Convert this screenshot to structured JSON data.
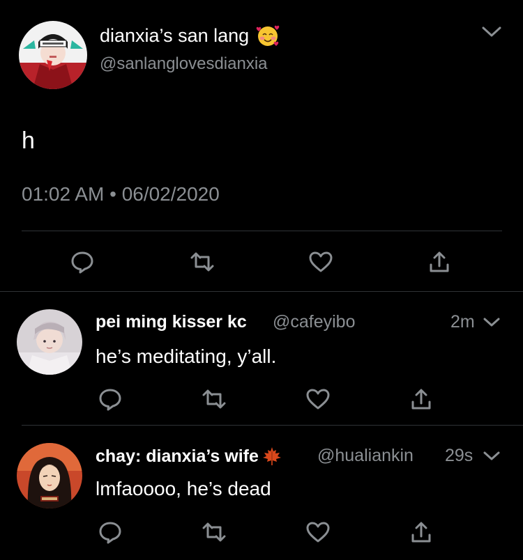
{
  "main_tweet": {
    "display_name": "dianxia’s san lang",
    "handle": "@sanlanglovesdianxia",
    "text": "h",
    "time": "01:02 AM",
    "separator": "•",
    "date": "06/02/2020",
    "name_emoji": "smiling-face-with-hearts"
  },
  "replies": [
    {
      "display_name": "pei ming kisser kc",
      "handle": "@cafeyibo",
      "time": "2m",
      "text": "he’s meditating, y’all."
    },
    {
      "display_name": "chay: dianxia’s wife",
      "name_emoji": "maple-leaf",
      "handle": "@hualiankin",
      "time": "29s",
      "text": "lmfaoooo, he’s dead"
    }
  ],
  "colors": {
    "background": "#000000",
    "primary_text": "#ffffff",
    "secondary_text": "#8b8f93",
    "divider": "#2f3336",
    "icon": "#8b8f93"
  },
  "icons": [
    "reply-icon",
    "retweet-icon",
    "like-icon",
    "share-icon",
    "chevron-down-icon"
  ]
}
